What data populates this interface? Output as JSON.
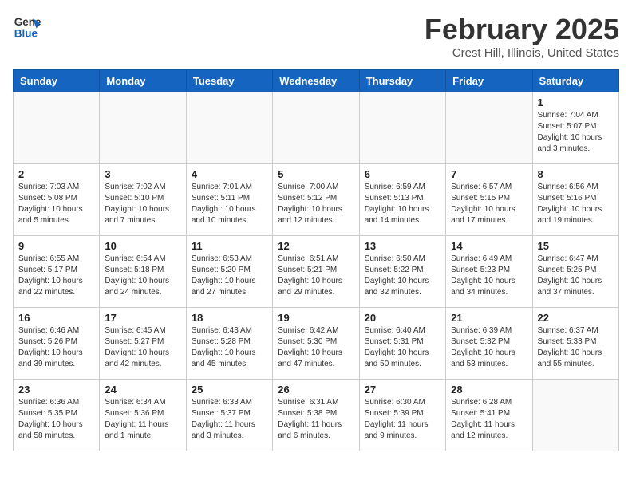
{
  "logo": {
    "line1": "General",
    "line2": "Blue"
  },
  "title": "February 2025",
  "subtitle": "Crest Hill, Illinois, United States",
  "weekdays": [
    "Sunday",
    "Monday",
    "Tuesday",
    "Wednesday",
    "Thursday",
    "Friday",
    "Saturday"
  ],
  "weeks": [
    [
      {
        "day": "",
        "info": ""
      },
      {
        "day": "",
        "info": ""
      },
      {
        "day": "",
        "info": ""
      },
      {
        "day": "",
        "info": ""
      },
      {
        "day": "",
        "info": ""
      },
      {
        "day": "",
        "info": ""
      },
      {
        "day": "1",
        "info": "Sunrise: 7:04 AM\nSunset: 5:07 PM\nDaylight: 10 hours and 3 minutes."
      }
    ],
    [
      {
        "day": "2",
        "info": "Sunrise: 7:03 AM\nSunset: 5:08 PM\nDaylight: 10 hours and 5 minutes."
      },
      {
        "day": "3",
        "info": "Sunrise: 7:02 AM\nSunset: 5:10 PM\nDaylight: 10 hours and 7 minutes."
      },
      {
        "day": "4",
        "info": "Sunrise: 7:01 AM\nSunset: 5:11 PM\nDaylight: 10 hours and 10 minutes."
      },
      {
        "day": "5",
        "info": "Sunrise: 7:00 AM\nSunset: 5:12 PM\nDaylight: 10 hours and 12 minutes."
      },
      {
        "day": "6",
        "info": "Sunrise: 6:59 AM\nSunset: 5:13 PM\nDaylight: 10 hours and 14 minutes."
      },
      {
        "day": "7",
        "info": "Sunrise: 6:57 AM\nSunset: 5:15 PM\nDaylight: 10 hours and 17 minutes."
      },
      {
        "day": "8",
        "info": "Sunrise: 6:56 AM\nSunset: 5:16 PM\nDaylight: 10 hours and 19 minutes."
      }
    ],
    [
      {
        "day": "9",
        "info": "Sunrise: 6:55 AM\nSunset: 5:17 PM\nDaylight: 10 hours and 22 minutes."
      },
      {
        "day": "10",
        "info": "Sunrise: 6:54 AM\nSunset: 5:18 PM\nDaylight: 10 hours and 24 minutes."
      },
      {
        "day": "11",
        "info": "Sunrise: 6:53 AM\nSunset: 5:20 PM\nDaylight: 10 hours and 27 minutes."
      },
      {
        "day": "12",
        "info": "Sunrise: 6:51 AM\nSunset: 5:21 PM\nDaylight: 10 hours and 29 minutes."
      },
      {
        "day": "13",
        "info": "Sunrise: 6:50 AM\nSunset: 5:22 PM\nDaylight: 10 hours and 32 minutes."
      },
      {
        "day": "14",
        "info": "Sunrise: 6:49 AM\nSunset: 5:23 PM\nDaylight: 10 hours and 34 minutes."
      },
      {
        "day": "15",
        "info": "Sunrise: 6:47 AM\nSunset: 5:25 PM\nDaylight: 10 hours and 37 minutes."
      }
    ],
    [
      {
        "day": "16",
        "info": "Sunrise: 6:46 AM\nSunset: 5:26 PM\nDaylight: 10 hours and 39 minutes."
      },
      {
        "day": "17",
        "info": "Sunrise: 6:45 AM\nSunset: 5:27 PM\nDaylight: 10 hours and 42 minutes."
      },
      {
        "day": "18",
        "info": "Sunrise: 6:43 AM\nSunset: 5:28 PM\nDaylight: 10 hours and 45 minutes."
      },
      {
        "day": "19",
        "info": "Sunrise: 6:42 AM\nSunset: 5:30 PM\nDaylight: 10 hours and 47 minutes."
      },
      {
        "day": "20",
        "info": "Sunrise: 6:40 AM\nSunset: 5:31 PM\nDaylight: 10 hours and 50 minutes."
      },
      {
        "day": "21",
        "info": "Sunrise: 6:39 AM\nSunset: 5:32 PM\nDaylight: 10 hours and 53 minutes."
      },
      {
        "day": "22",
        "info": "Sunrise: 6:37 AM\nSunset: 5:33 PM\nDaylight: 10 hours and 55 minutes."
      }
    ],
    [
      {
        "day": "23",
        "info": "Sunrise: 6:36 AM\nSunset: 5:35 PM\nDaylight: 10 hours and 58 minutes."
      },
      {
        "day": "24",
        "info": "Sunrise: 6:34 AM\nSunset: 5:36 PM\nDaylight: 11 hours and 1 minute."
      },
      {
        "day": "25",
        "info": "Sunrise: 6:33 AM\nSunset: 5:37 PM\nDaylight: 11 hours and 3 minutes."
      },
      {
        "day": "26",
        "info": "Sunrise: 6:31 AM\nSunset: 5:38 PM\nDaylight: 11 hours and 6 minutes."
      },
      {
        "day": "27",
        "info": "Sunrise: 6:30 AM\nSunset: 5:39 PM\nDaylight: 11 hours and 9 minutes."
      },
      {
        "day": "28",
        "info": "Sunrise: 6:28 AM\nSunset: 5:41 PM\nDaylight: 11 hours and 12 minutes."
      },
      {
        "day": "",
        "info": ""
      }
    ]
  ]
}
